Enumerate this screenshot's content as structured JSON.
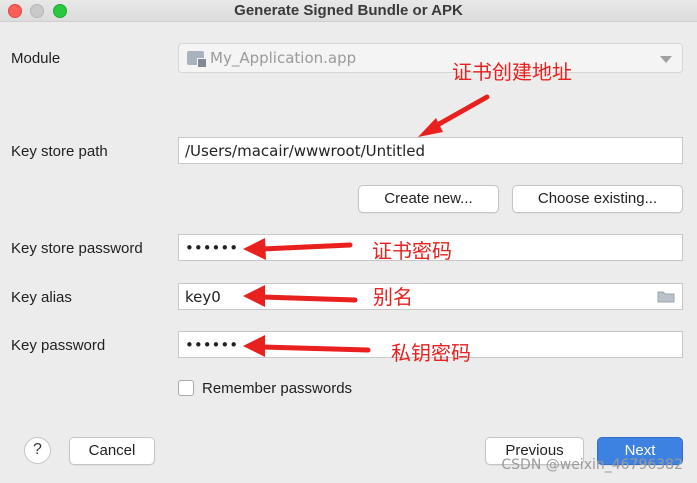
{
  "window": {
    "title": "Generate Signed Bundle or APK"
  },
  "form": {
    "module_label": "Module",
    "module_value": "My_Application.app",
    "keystore_path_label": "Key store path",
    "keystore_path_value": "/Users/macair/wwwroot/Untitled",
    "create_new_label": "Create new...",
    "choose_existing_label": "Choose existing...",
    "keystore_password_label": "Key store password",
    "keystore_password_value": "••••••",
    "key_alias_label": "Key alias",
    "key_alias_value": "key0",
    "key_password_label": "Key password",
    "key_password_value": "••••••",
    "remember_label": "Remember passwords"
  },
  "footer": {
    "help_label": "?",
    "cancel_label": "Cancel",
    "previous_label": "Previous",
    "next_label": "Next"
  },
  "annotations": {
    "keystore_path_note": "证书创建地址",
    "keystore_password_note": "证书密码",
    "key_alias_note": "别名",
    "key_password_note": "私钥密码"
  },
  "watermark": "CSDN @weixin_46796382",
  "colors": {
    "annotation": "#e8201e",
    "primary_button": "#3d82e0"
  },
  "icons": {
    "module": "module-icon",
    "dropdown": "chevron-down-icon",
    "folder": "folder-icon"
  }
}
